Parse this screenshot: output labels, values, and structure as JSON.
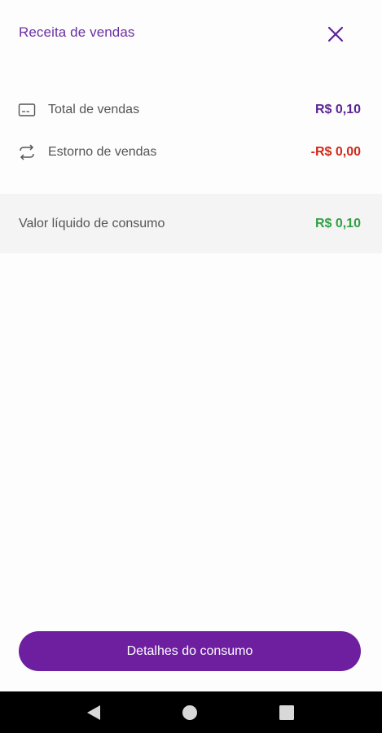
{
  "header": {
    "title": "Receita de vendas",
    "close_icon": "close-icon"
  },
  "summary": {
    "rows": [
      {
        "icon": "credit-card-icon",
        "label": "Total de vendas",
        "value": "R$ 0,10",
        "color": "#5b2397"
      },
      {
        "icon": "refund-arrows-icon",
        "label": "Estorno de vendas",
        "value": "-R$ 0,00",
        "color": "#d0291b"
      }
    ],
    "net": {
      "label": "Valor líquido de consumo",
      "value": "R$ 0,10",
      "color": "#2fa043"
    }
  },
  "actions": {
    "details_label": "Detalhes do consumo",
    "button_color": "#6d1fa0"
  },
  "system_nav": {
    "back_icon": "back-triangle-icon",
    "home_icon": "home-circle-icon",
    "recent_icon": "recent-square-icon"
  }
}
